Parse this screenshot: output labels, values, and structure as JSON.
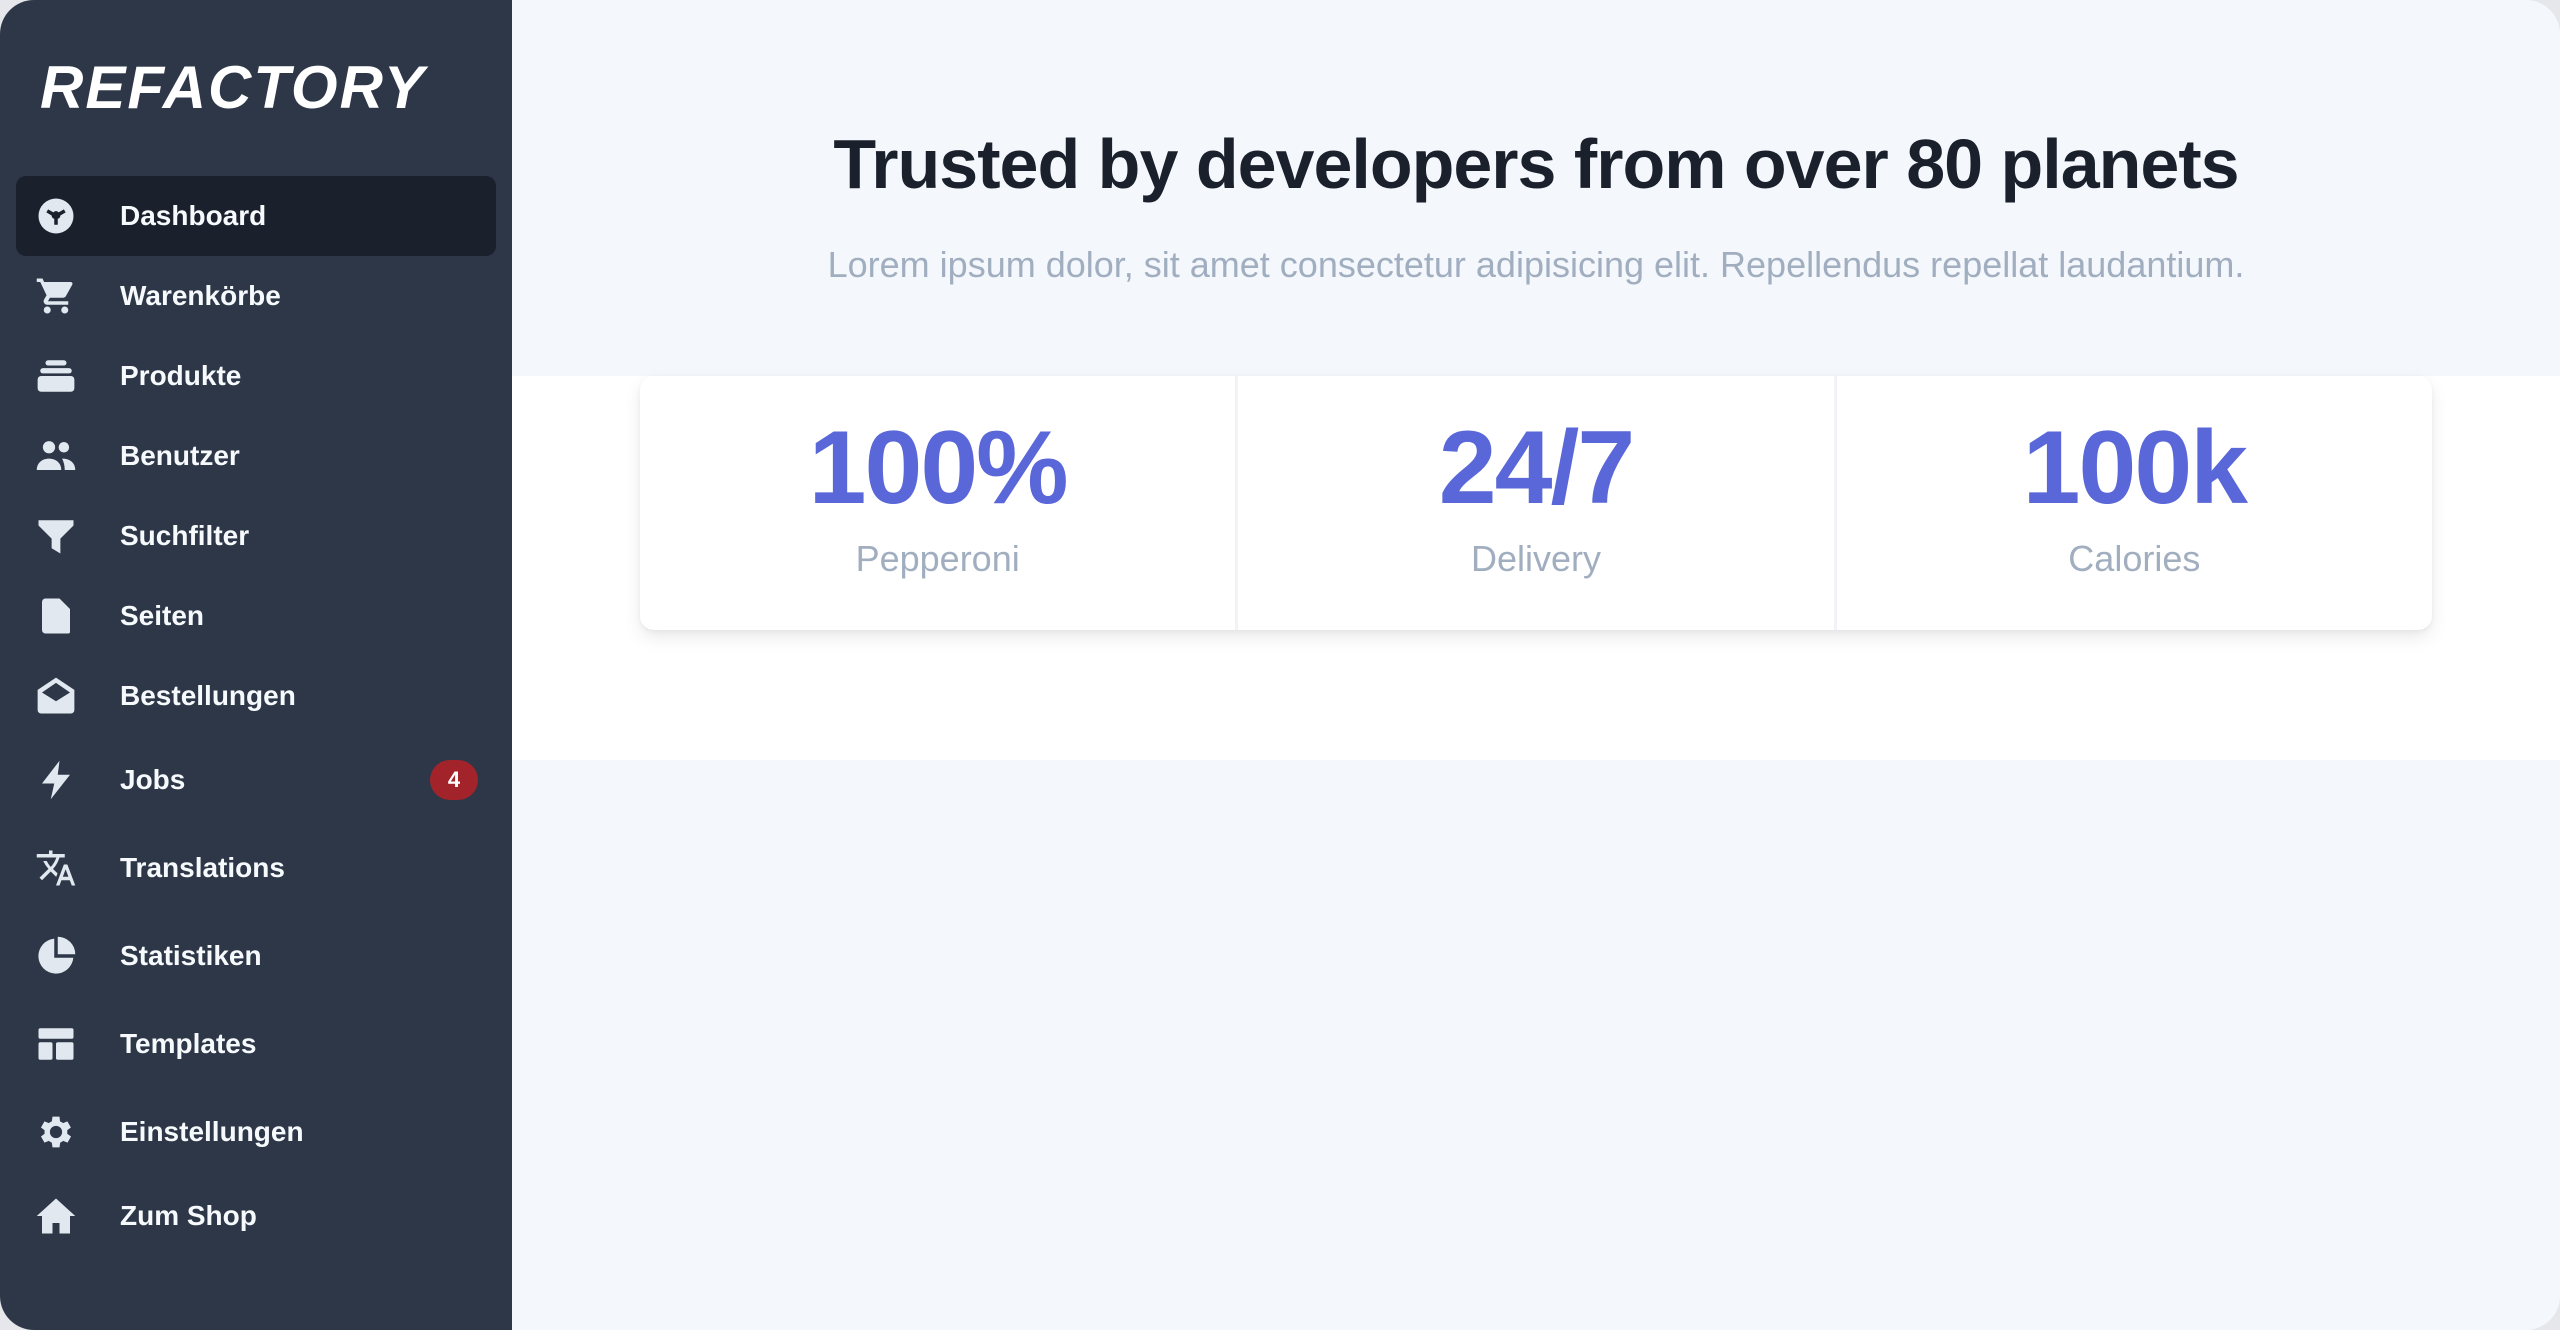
{
  "brand": {
    "logo_text": "REFACTORY"
  },
  "sidebar": {
    "items": [
      {
        "label": "Dashboard",
        "icon": "dashboard-icon",
        "active": true
      },
      {
        "label": "Warenkörbe",
        "icon": "cart-icon"
      },
      {
        "label": "Produkte",
        "icon": "products-stack-icon"
      },
      {
        "label": "Benutzer",
        "icon": "users-icon"
      },
      {
        "label": "Suchfilter",
        "icon": "filter-icon"
      },
      {
        "label": "Seiten",
        "icon": "page-icon"
      },
      {
        "label": "Bestellungen",
        "icon": "envelope-open-icon"
      },
      {
        "label": "Jobs",
        "icon": "lightning-icon",
        "badge": "4"
      },
      {
        "label": "Translations",
        "icon": "translate-icon"
      },
      {
        "label": "Statistiken",
        "icon": "pie-chart-icon"
      },
      {
        "label": "Templates",
        "icon": "template-icon"
      },
      {
        "label": "Einstellungen",
        "icon": "gear-icon"
      },
      {
        "label": "Zum Shop",
        "icon": "home-icon"
      }
    ]
  },
  "main": {
    "headline": "Trusted by developers from over 80 planets",
    "subline": "Lorem ipsum dolor, sit amet consectetur adipisicing elit. Repellendus repellat laudantium.",
    "stats": [
      {
        "value": "100%",
        "label": "Pepperoni"
      },
      {
        "value": "24/7",
        "label": "Delivery"
      },
      {
        "value": "100k",
        "label": "Calories"
      }
    ]
  },
  "colors": {
    "sidebar_bg": "#2d3748",
    "active_item_bg": "#1a202c",
    "accent": "#5a67d8",
    "badge": "#a3232a",
    "muted_text": "#a0aec0",
    "heading_text": "#1a202c"
  }
}
